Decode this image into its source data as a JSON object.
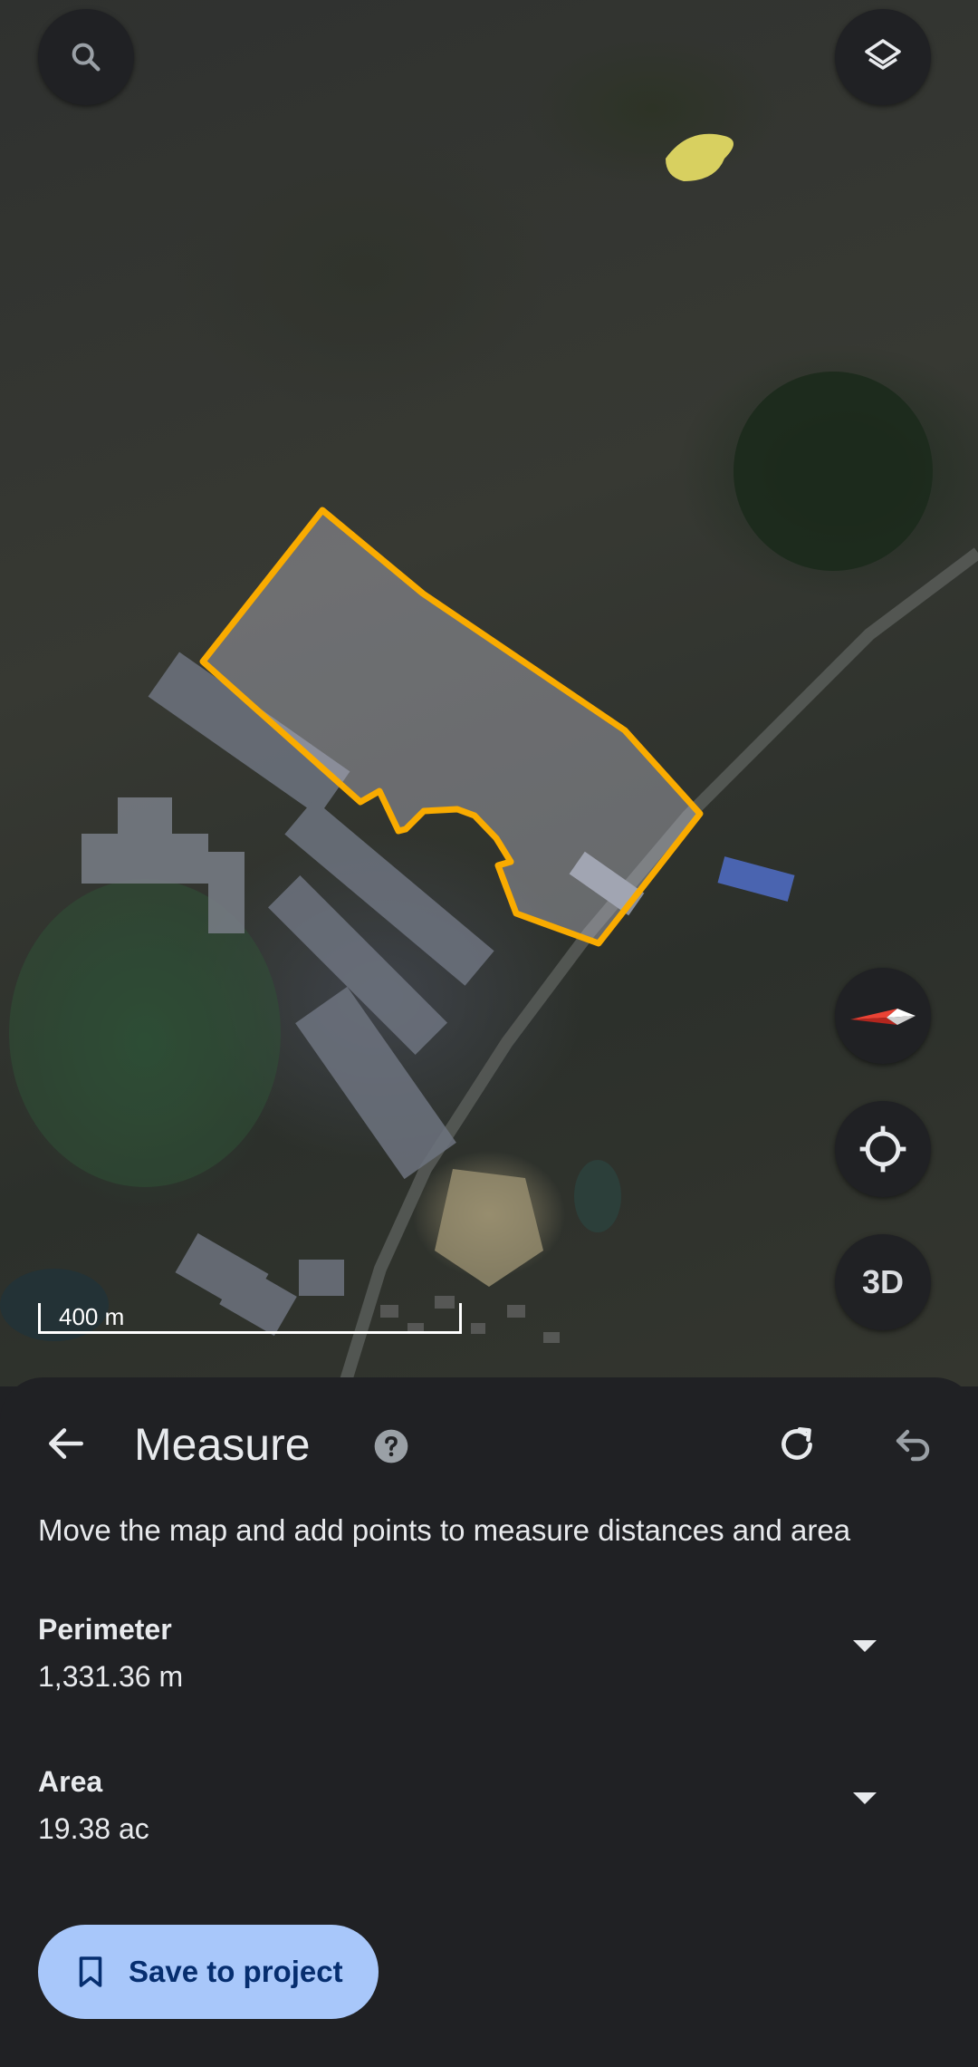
{
  "map": {
    "scale_label": "400 m",
    "polygon_color": "#f9ab00",
    "three_d_label": "3D"
  },
  "icons": {
    "search": "search-icon",
    "layers": "layers-icon",
    "compass": "compass-icon",
    "my_location": "my-location-icon",
    "back": "back-arrow-icon",
    "help": "help-icon",
    "redo": "redo-icon",
    "undo": "undo-icon",
    "bookmark": "bookmark-icon"
  },
  "measure": {
    "title": "Measure",
    "description": "Move the map and add points to measure distances and area",
    "perimeter_label": "Perimeter",
    "perimeter_value": "1,331.36 m",
    "area_label": "Area",
    "area_value": "19.38 ac",
    "save_label": "Save to project"
  },
  "colors": {
    "sheet_bg": "#202124",
    "save_button_bg": "#a8c7fa",
    "compass_red": "#ea4335"
  }
}
